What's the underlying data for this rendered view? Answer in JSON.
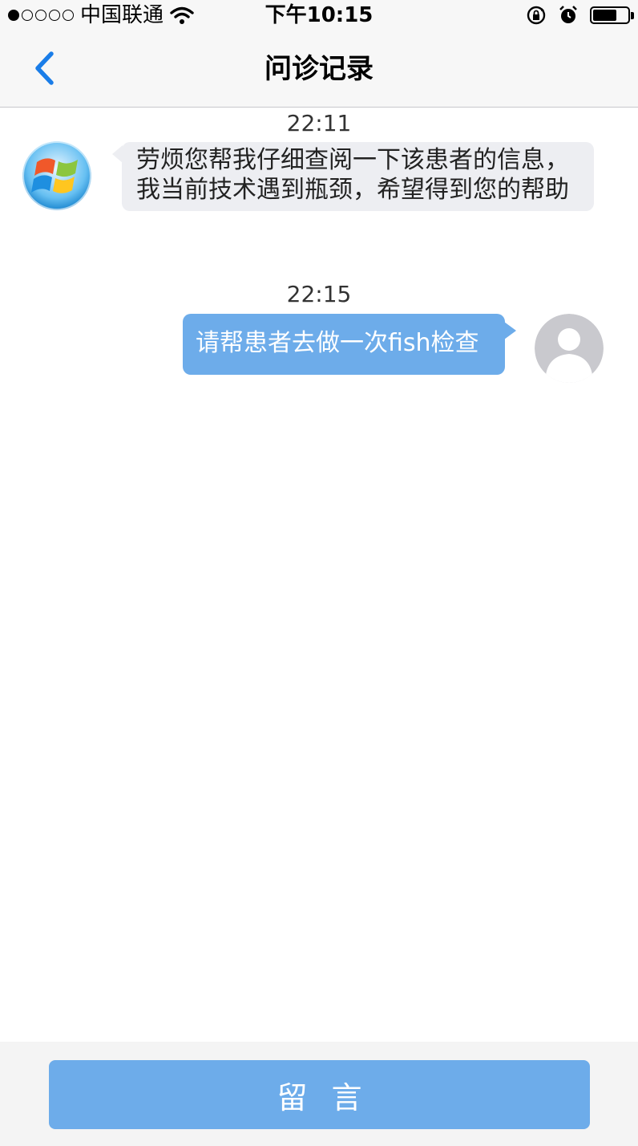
{
  "status_bar": {
    "carrier": "中国联通",
    "time": "下午10:15",
    "signal_bars_filled": 1,
    "signal_bars_total": 5,
    "battery_level": 0.7
  },
  "nav": {
    "title": "问诊记录",
    "back_icon": "chevron-left-icon",
    "accent_color": "#1a7de8"
  },
  "messages": [
    {
      "time": "22:11",
      "direction": "incoming",
      "avatar": "windows-logo-avatar",
      "text": "劳烦您帮我仔细查阅一下该患者的信息，我当前技术遇到瓶颈，希望得到您的帮助"
    },
    {
      "time": "22:15",
      "direction": "outgoing",
      "avatar": "default-user-avatar",
      "text": "请帮患者去做一次fish检查"
    }
  ],
  "colors": {
    "incoming_bubble": "#edeef2",
    "outgoing_bubble": "#6dacea",
    "button": "#6dacea"
  },
  "footer": {
    "button_label": "留言"
  }
}
